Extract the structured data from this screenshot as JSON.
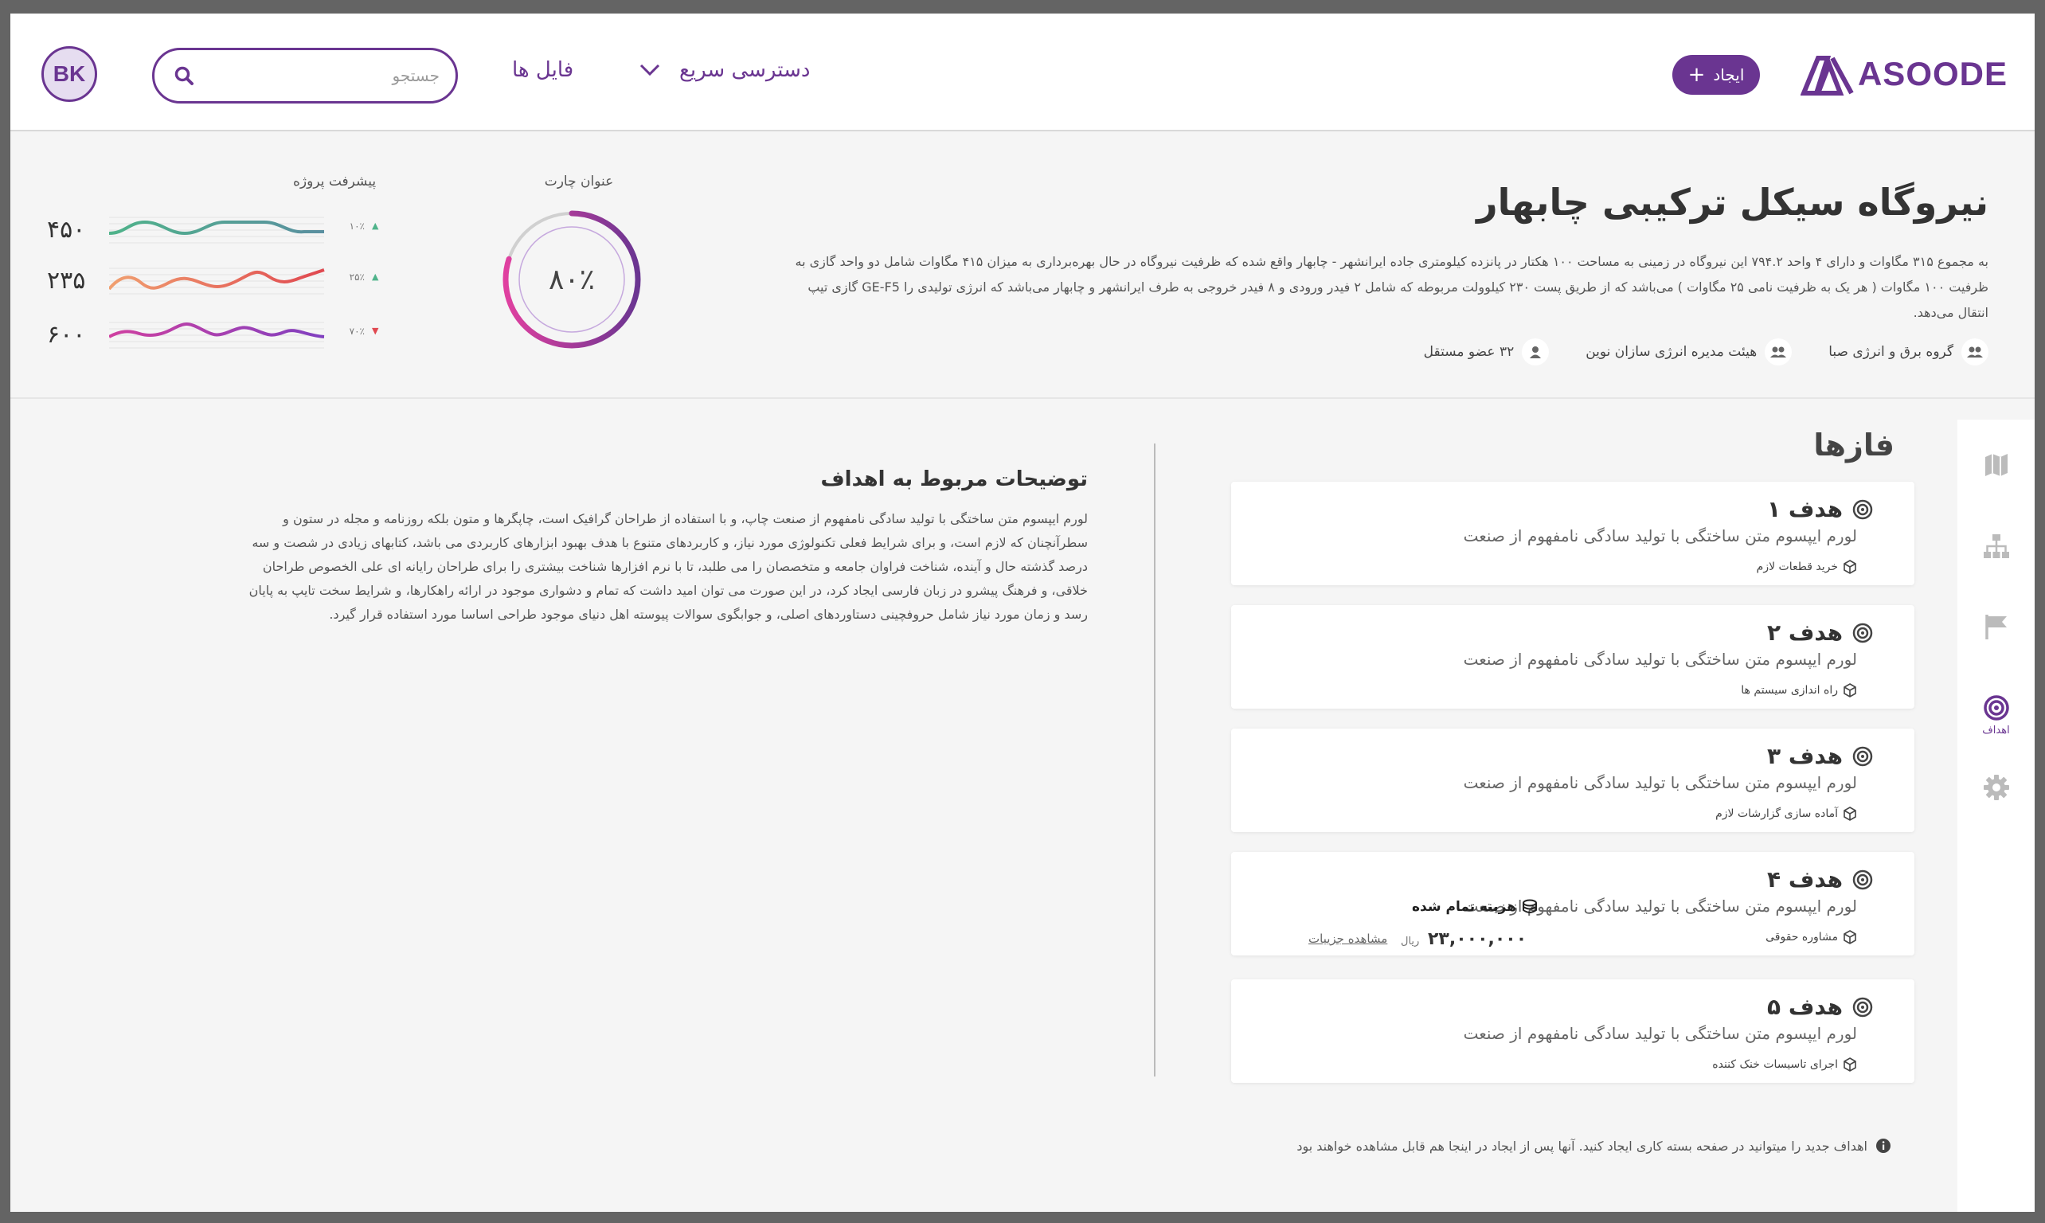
{
  "header": {
    "logo_text": "ASOODE",
    "create_label": "ایجاد",
    "quick_access_label": "دسترسی سریع",
    "files_label": "فایل ها",
    "search_placeholder": "جستجو",
    "avatar_initials": "BK"
  },
  "project": {
    "title": "نیروگاه سیکل ترکیبی چابهار",
    "description": "به مجموع ۳۱۵ مگاوات و دارای ۴ واحد ۷۹۴.۲ این نیروگاه در زمینی به مساحت ۱۰۰ هکتار در پانزده کیلومتری جاده ایرانشهر - چابهار واقع شده که ظرفیت نیروگاه در حال بهره‌برداری به میزان ۴۱۵ مگاوات شامل دو واحد گازی به ظرفیت ۱۰۰ مگاوات ( هر یک به ظرفیت نامی ۲۵ مگاوات ) می‌باشد که از طریق پست ۲۳۰ کیلوولت مربوطه که شامل ۲ فیدر ورودی و ۸ فیدر خروجی به طرف ایرانشهر و چابهار می‌باشد که انرژی تولیدی را GE-F5 گازی تیپ انتقال می‌دهد.",
    "stakeholders": [
      {
        "label": "گروه برق و انرژی صبا",
        "icon": "group-icon"
      },
      {
        "label": "هیئت مدیره انرژی سازان نوین",
        "icon": "group-icon"
      },
      {
        "label": "۳۲ عضو مستقل",
        "icon": "person-icon"
      }
    ]
  },
  "chart_widget": {
    "title": "عنوان چارت",
    "value_text": "۸۰٪",
    "percent": 80,
    "colors": {
      "start": "#e040a0",
      "end": "#6a3591",
      "track": "#d0d0d0"
    }
  },
  "progress": {
    "title": "پیشرفت پروژه",
    "rows": [
      {
        "value": "۴۵۰",
        "percent": "۱۰٪",
        "trend": "up",
        "trend_symbol": "▲",
        "colors": [
          "#4fb38a",
          "#5a8fa0"
        ]
      },
      {
        "value": "۲۳۵",
        "percent": "۲۵٪",
        "trend": "up",
        "trend_symbol": "▲",
        "colors": [
          "#f0a070",
          "#e04850"
        ]
      },
      {
        "value": "۶۰۰",
        "percent": "۷۰٪",
        "trend": "down",
        "trend_symbol": "▼",
        "colors": [
          "#d040a0",
          "#8040c0"
        ]
      }
    ]
  },
  "phases": {
    "title": "فازها",
    "goals": [
      {
        "title": "هدف ۱",
        "desc": "لورم ایپسوم متن ساختگی با تولید سادگی نامفهوم از صنعت",
        "tag": "خرید قطعات لازم"
      },
      {
        "title": "هدف ۲",
        "desc": "لورم ایپسوم متن ساختگی با تولید سادگی نامفهوم از صنعت",
        "tag": "راه اندازی سیستم ها"
      },
      {
        "title": "هدف ۳",
        "desc": "لورم ایپسوم متن ساختگی با تولید سادگی نامفهوم از صنعت",
        "tag": "آماده سازی گزارشات لازم"
      },
      {
        "title": "هدف ۴",
        "desc": "لورم ایپسوم متن ساختگی با تولید سادگی نامفهوم از صنعت",
        "tag": "مشاوره حقوقی"
      },
      {
        "title": "هدف ۵",
        "desc": "لورم ایپسوم متن ساختگی با تولید سادگی نامفهوم از صنعت",
        "tag": "اجرای تاسیسات خنک کننده"
      }
    ],
    "cost": {
      "label": "هزینه تمام شده",
      "value": "۲۳,۰۰۰,۰۰۰",
      "unit": "ریال",
      "details_link": "مشاهده جزییات"
    },
    "info_note": "اهداف جدید را میتوانید در صفحه بسته کاری ایجاد کنید. آنها پس از ایجاد در اینجا هم قابل مشاهده خواهند بود"
  },
  "goals_description": {
    "title": "توضیحات مربوط به اهداف",
    "text": "لورم ایپسوم متن ساختگی با تولید سادگی نامفهوم از صنعت چاپ، و با استفاده از طراحان گرافیک است، چاپگرها و متون بلکه روزنامه و مجله در ستون و سطرآنچنان که لازم است، و برای شرایط فعلی تکنولوژی مورد نیاز، و کاربردهای متنوع با هدف بهبود ابزارهای کاربردی می باشد، کتابهای زیادی در شصت و سه درصد گذشته حال و آینده، شناخت فراوان جامعه و متخصصان را می طلبد، تا با نرم افزارها شناخت بیشتری را برای طراحان رایانه ای علی الخصوص طراحان خلاقی، و فرهنگ پیشرو در زبان فارسی ایجاد کرد، در این صورت می توان امید داشت که تمام و دشواری موجود در ارائه راهکارها، و شرایط سخت تایپ به پایان رسد و زمان مورد نیاز شامل حروفچینی دستاوردهای اصلی، و جوابگوی سوالات پیوسته اهل دنیای موجود طراحی اساسا مورد استفاده قرار گیرد."
  },
  "rail": {
    "items": [
      {
        "name": "map-icon",
        "label": ""
      },
      {
        "name": "org-chart-icon",
        "label": ""
      },
      {
        "name": "flag-icon",
        "label": ""
      },
      {
        "name": "target-icon",
        "label": "اهداف",
        "active": true
      },
      {
        "name": "settings-icon",
        "label": ""
      }
    ]
  }
}
